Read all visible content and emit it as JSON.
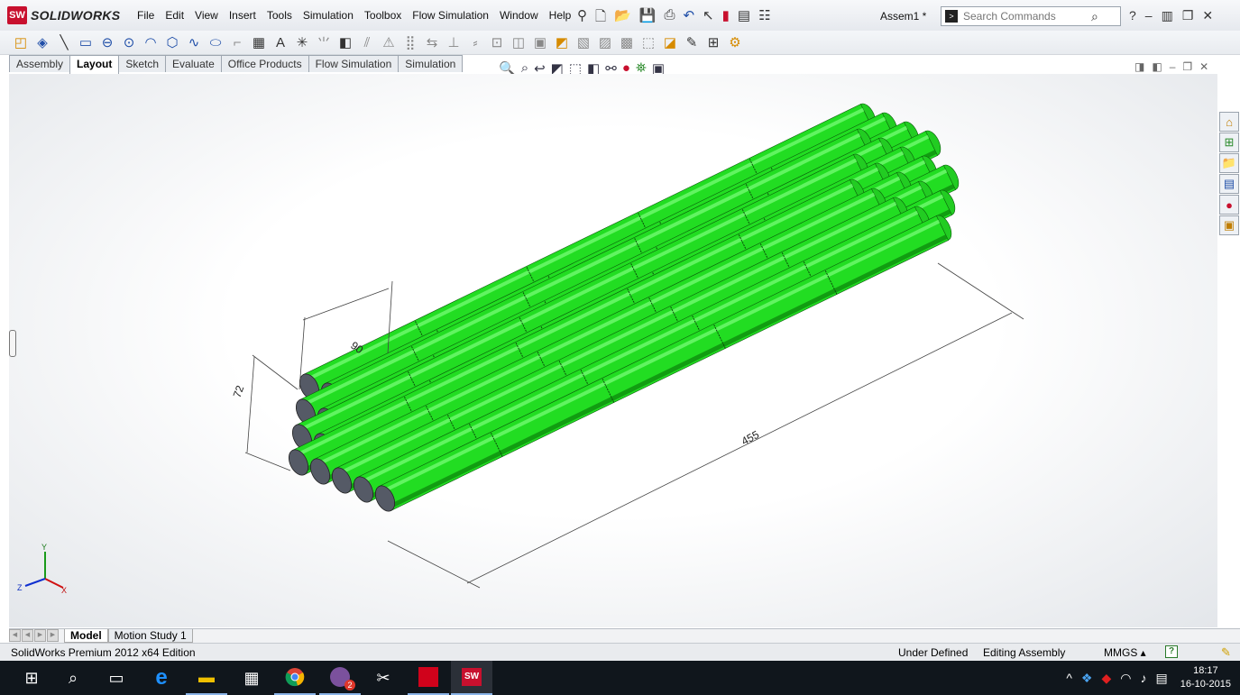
{
  "app": {
    "brand": "SOLIDWORKS",
    "badge": "SW"
  },
  "menu": [
    "File",
    "Edit",
    "View",
    "Insert",
    "Tools",
    "Simulation",
    "Toolbox",
    "Flow Simulation",
    "Window",
    "Help"
  ],
  "document_title": "Assem1 *",
  "search": {
    "placeholder": "Search Commands"
  },
  "tabs": [
    {
      "label": "Assembly",
      "active": false
    },
    {
      "label": "Layout",
      "active": true
    },
    {
      "label": "Sketch",
      "active": false
    },
    {
      "label": "Evaluate",
      "active": false
    },
    {
      "label": "Office Products",
      "active": false
    },
    {
      "label": "Flow Simulation",
      "active": false
    },
    {
      "label": "Simulation",
      "active": false
    }
  ],
  "model": {
    "dimensions": {
      "width": "90",
      "height": "72",
      "length": "455"
    },
    "cylinder_color": "#22dd22",
    "end_color": "#555a66",
    "segments": 5
  },
  "triad": {
    "x": "X",
    "y": "Y",
    "z": "Z"
  },
  "bottom_tabs": [
    {
      "label": "Model",
      "active": true
    },
    {
      "label": "Motion Study 1",
      "active": false
    }
  ],
  "status": {
    "edition": "SolidWorks Premium 2012 x64 Edition",
    "definition": "Under Defined",
    "mode": "Editing Assembly",
    "units": "MMGS",
    "help_glyph": "?"
  },
  "taskbar": {
    "time": "18:17",
    "date": "16-10-2015",
    "viber_badge": "2",
    "sw_label": "SW"
  },
  "colors": {
    "accent": "#c8102e",
    "taskbar": "#10161c"
  }
}
